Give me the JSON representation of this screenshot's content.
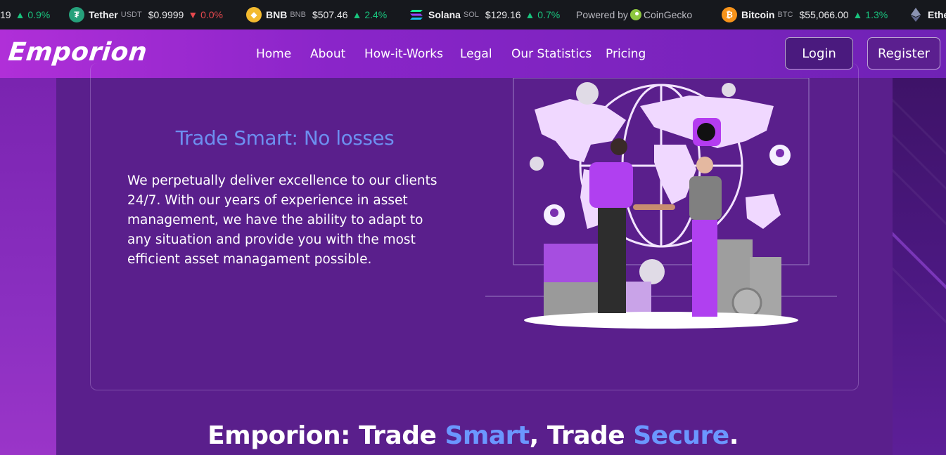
{
  "ticker": {
    "items": [
      {
        "name": "",
        "symbol": "",
        "price": "19",
        "change": "0.9%",
        "direction": "up",
        "icon": "none"
      },
      {
        "name": "Tether",
        "symbol": "USDT",
        "price": "$0.9999",
        "change": "0.0%",
        "direction": "down",
        "icon": "tether-icon",
        "color": "#26a17b"
      },
      {
        "name": "BNB",
        "symbol": "BNB",
        "price": "$507.46",
        "change": "2.4%",
        "direction": "up",
        "icon": "bnb-icon",
        "color": "#f3ba2f"
      },
      {
        "name": "Solana",
        "symbol": "SOL",
        "price": "$129.16",
        "change": "0.7%",
        "direction": "up",
        "icon": "solana-icon"
      },
      {
        "name": "Bitcoin",
        "symbol": "BTC",
        "price": "$55,066.00",
        "change": "1.3%",
        "direction": "up",
        "icon": "bitcoin-icon",
        "color": "#f7931a"
      },
      {
        "name": "Ethe",
        "icon": "ethereum-icon"
      }
    ],
    "powered_by": "Powered by",
    "powered_brand": "CoinGecko"
  },
  "header": {
    "logo": "Emporion",
    "nav": [
      "Home",
      "About",
      "How-it-Works",
      "Legal",
      "Our Statistics",
      "Pricing"
    ],
    "login": "Login",
    "register": "Register"
  },
  "hero": {
    "title": "Trade Smart: No losses",
    "text": "We perpetually deliver excellence to our clients 24/7. With our years of experience in asset management, we have the ability to adapt to any situation and provide you with the most efficient asset managament possible."
  },
  "section": {
    "title_part1": "Emporion: Trade ",
    "title_accent1": "Smart",
    "title_part2": ", Trade ",
    "title_accent2": "Secure",
    "title_part3": "."
  },
  "colors": {
    "accent": "#6b97ff",
    "up": "#19c37d",
    "down": "#e5484d",
    "header_start": "#b02fd8",
    "header_end": "#6f22b5",
    "page": "#5a1f8c"
  }
}
